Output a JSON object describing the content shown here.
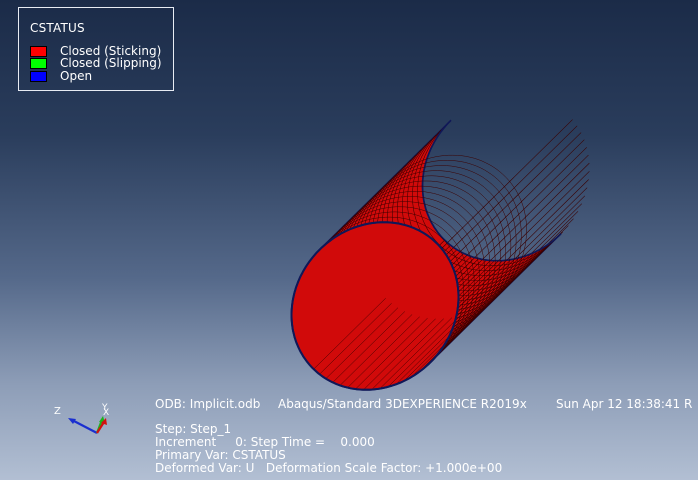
{
  "legend": {
    "title": "CSTATUS",
    "items": [
      {
        "label": "Closed (Sticking)",
        "color": "#ff0000"
      },
      {
        "label": "Closed (Slipping)",
        "color": "#00ff00"
      },
      {
        "label": "Open",
        "color": "#0000ff"
      }
    ]
  },
  "model": {
    "mesh_color": "#d10a0a",
    "mesh_line_color": "#3a0000",
    "edge_color": "#101858"
  },
  "triad": {
    "z_label": "Z",
    "y_label": "Y",
    "x_label": "X"
  },
  "info": {
    "odb": "ODB: Implicit.odb",
    "solver": "Abaqus/Standard 3DEXPERIENCE R2019x",
    "date": "Sun Apr 12 18:38:41 R",
    "step": "Step: Step_1",
    "increment": "Increment     0: Step Time =    0.000",
    "primary_var": "Primary Var: CSTATUS",
    "deformed_var": "Deformed Var: U   Deformation Scale Factor: +1.000e+00"
  }
}
